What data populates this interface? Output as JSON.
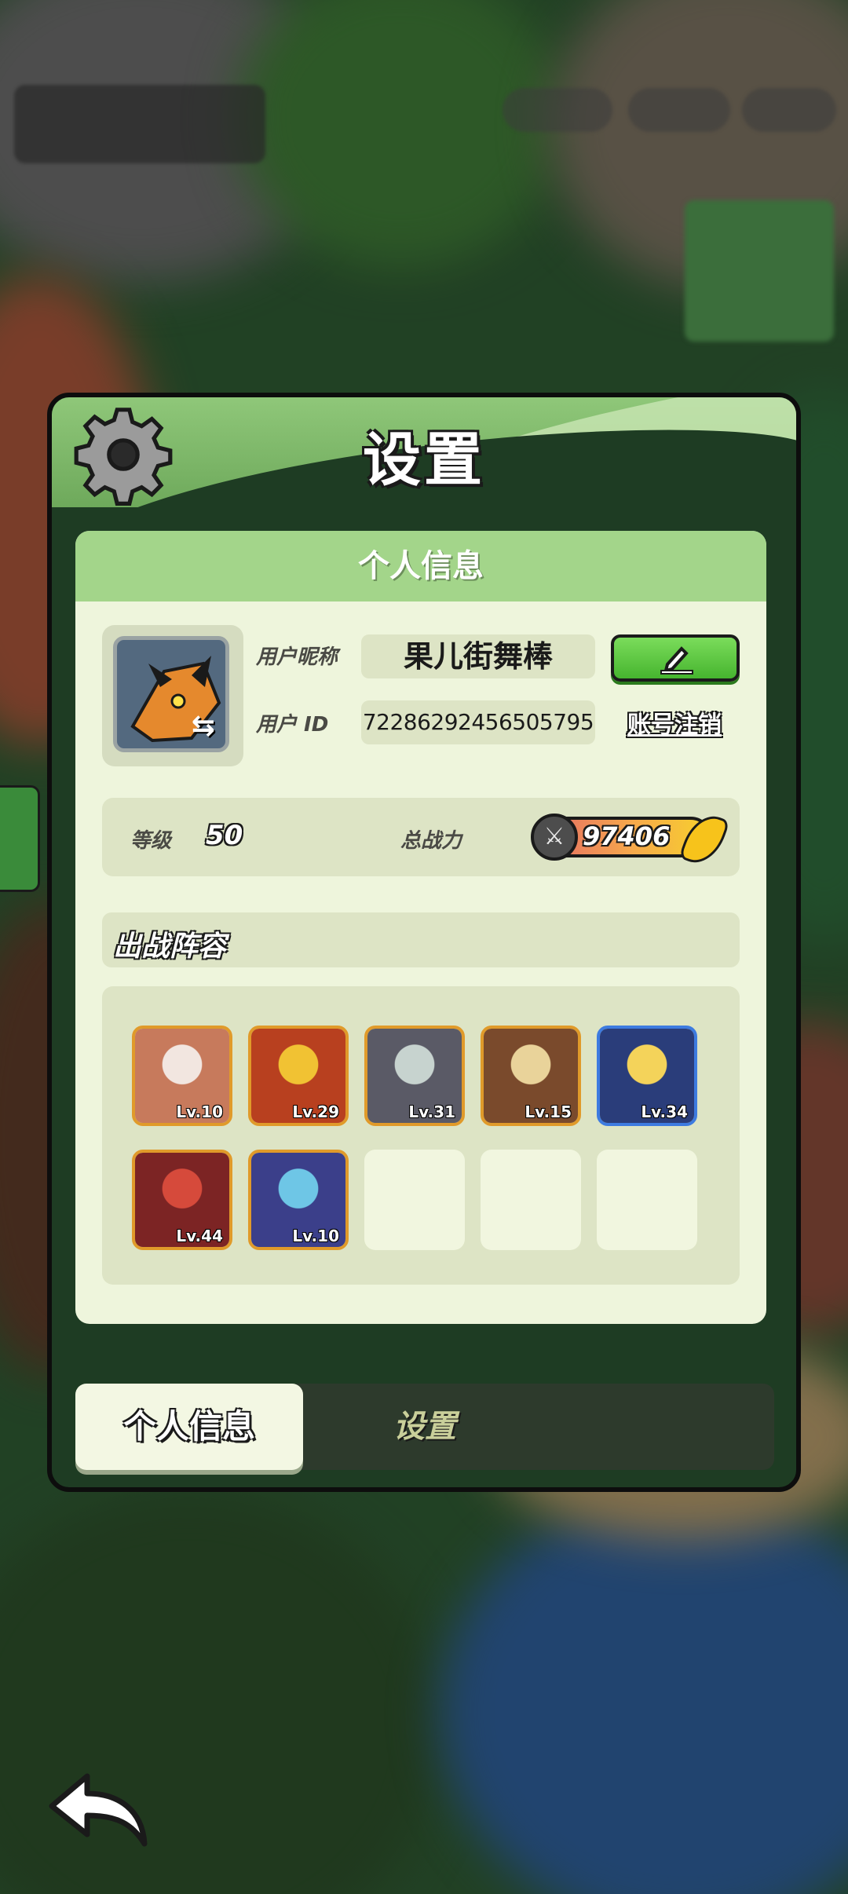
{
  "panel": {
    "title": "设置"
  },
  "personal_info": {
    "header": "个人信息",
    "nickname_label": "用户昵称",
    "nickname_value": "果儿街舞棒",
    "id_label": "用户 ID",
    "id_value": "72286292456505795",
    "cancel_account_link": "账号注销",
    "level_label": "等级",
    "level_value": "50",
    "power_label": "总战力",
    "power_value": "97406"
  },
  "lineup": {
    "title": "出战阵容",
    "heroes": [
      {
        "level": "Lv.10",
        "color": "#c77a5c",
        "accent": "#f2e6e0"
      },
      {
        "level": "Lv.29",
        "color": "#b8401f",
        "accent": "#f1c233"
      },
      {
        "level": "Lv.31",
        "color": "#5a5a66",
        "accent": "#c7d3cf"
      },
      {
        "level": "Lv.15",
        "color": "#7a4a2c",
        "accent": "#e9d39a"
      },
      {
        "level": "Lv.34",
        "color": "#2a3d7a",
        "accent": "#f4d35a"
      },
      {
        "level": "Lv.44",
        "color": "#7c2424",
        "accent": "#d64a3b"
      },
      {
        "level": "Lv.10",
        "color": "#3b3f8a",
        "accent": "#6ec6e6"
      }
    ],
    "empty_slots": 3
  },
  "tabs": {
    "personal": "个人信息",
    "settings": "设置"
  },
  "icons": {
    "gear": "gear-icon",
    "edit": "pencil-icon",
    "swap": "swap-icon",
    "power": "crossed-swords-icon",
    "back": "back-arrow-icon"
  }
}
